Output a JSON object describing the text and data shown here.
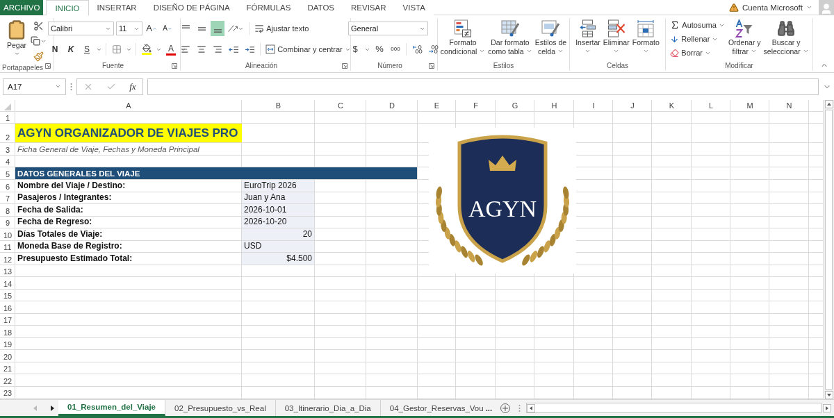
{
  "file_tab": "ARCHIVO",
  "tabs": [
    {
      "label": "INICIO",
      "selected": true
    },
    {
      "label": "INSERTAR",
      "selected": false
    },
    {
      "label": "DISEÑO DE PÁGINA",
      "selected": false
    },
    {
      "label": "FÓRMULAS",
      "selected": false
    },
    {
      "label": "DATOS",
      "selected": false
    },
    {
      "label": "REVISAR",
      "selected": false
    },
    {
      "label": "VISTA",
      "selected": false
    }
  ],
  "account": "Cuenta Microsoft",
  "ribbon": {
    "clipboard": {
      "label": "Portapapeles",
      "launcher": true,
      "paste": "Pegar"
    },
    "font": {
      "label": "Fuente",
      "launcher": true,
      "font_name": "Calibri",
      "font_size": "11",
      "grow": "A",
      "shrink": "A",
      "bold": "N",
      "italic": "K",
      "underline": "S",
      "font_color": "A"
    },
    "alignment": {
      "label": "Alineación",
      "launcher": true,
      "wrap_text": "Ajustar texto",
      "merge": "Combinar y centrar",
      "align_buttons": [
        {
          "kind": "top",
          "selected": false
        },
        {
          "kind": "middle",
          "selected": false
        },
        {
          "kind": "bottom",
          "selected": true
        }
      ]
    },
    "number": {
      "label": "Número",
      "launcher": true,
      "format": "General",
      "currency": "$",
      "percent": "%",
      "thousands": "000"
    },
    "styles": {
      "label": "Estilos",
      "launcher": false,
      "buttons": [
        {
          "kind": "conditional",
          "lines": [
            "Formato",
            "condicional"
          ]
        },
        {
          "kind": "table",
          "lines": [
            "Dar formato",
            "como tabla"
          ]
        },
        {
          "kind": "cellstyle",
          "lines": [
            "Estilos de",
            "celda"
          ]
        }
      ]
    },
    "cells": {
      "label": "Celdas",
      "launcher": false,
      "buttons": [
        {
          "kind": "insert",
          "label": "Insertar"
        },
        {
          "kind": "delete",
          "label": "Eliminar"
        },
        {
          "kind": "format",
          "label": "Formato"
        }
      ]
    },
    "editing": {
      "label": "Modificar",
      "launcher": false,
      "autosum": "Autosuma",
      "fill": "Rellenar",
      "clear": "Borrar",
      "buttons": [
        {
          "kind": "sort",
          "lines": [
            "Ordenar y",
            "filtrar"
          ]
        },
        {
          "kind": "find",
          "lines": [
            "Buscar y",
            "seleccionar"
          ]
        }
      ]
    }
  },
  "formula_bar": {
    "name_box": "A17",
    "fx": "fx"
  },
  "sheet": {
    "columns": [
      "A",
      "B",
      "C",
      "D",
      "E",
      "F",
      "G",
      "H",
      "I",
      "J",
      "K",
      "L",
      "M",
      "N"
    ],
    "row_numbers": [
      "1",
      "2",
      "3",
      "4",
      "5",
      "6",
      "7",
      "8",
      "9",
      "10",
      "11",
      "12",
      "13",
      "14",
      "15",
      "16",
      "17",
      "18",
      "19",
      "20",
      "21",
      "22",
      "23"
    ],
    "title": "AGYN ORGANIZADOR DE VIAJES PRO",
    "subtitle": "Ficha General de Viaje, Fechas y Moneda Principal",
    "section": "DATOS GENERALES DEL VIAJE",
    "fields": [
      {
        "label": "Nombre del Viaje / Destino:",
        "value": "EuroTrip 2026",
        "kind": "text"
      },
      {
        "label": "Pasajeros / Integrantes:",
        "value": "Juan y Ana",
        "kind": "text"
      },
      {
        "label": "Fecha de Salida:",
        "value": "2026-10-01",
        "kind": "text"
      },
      {
        "label": "Fecha de Regreso:",
        "value": "2026-10-20",
        "kind": "text"
      },
      {
        "label": "Días Totales de Viaje:",
        "value": "20",
        "kind": "number"
      },
      {
        "label": "Moneda Base de Registro:",
        "value": "USD",
        "kind": "text"
      },
      {
        "label": "Presupuesto Estimado Total:",
        "value": "$4.500",
        "kind": "number"
      }
    ],
    "logo": {
      "text": "AGYN"
    }
  },
  "sheet_tabs": [
    {
      "label": "01_Resumen_del_Viaje",
      "selected": true
    },
    {
      "label": "02_Presupuesto_vs_Real",
      "selected": false
    },
    {
      "label": "03_Itinerario_Dia_a_Dia",
      "selected": false
    },
    {
      "label": "04_Gestor_Reservas_Vou",
      "selected": false
    }
  ],
  "more_tabs": "..."
}
